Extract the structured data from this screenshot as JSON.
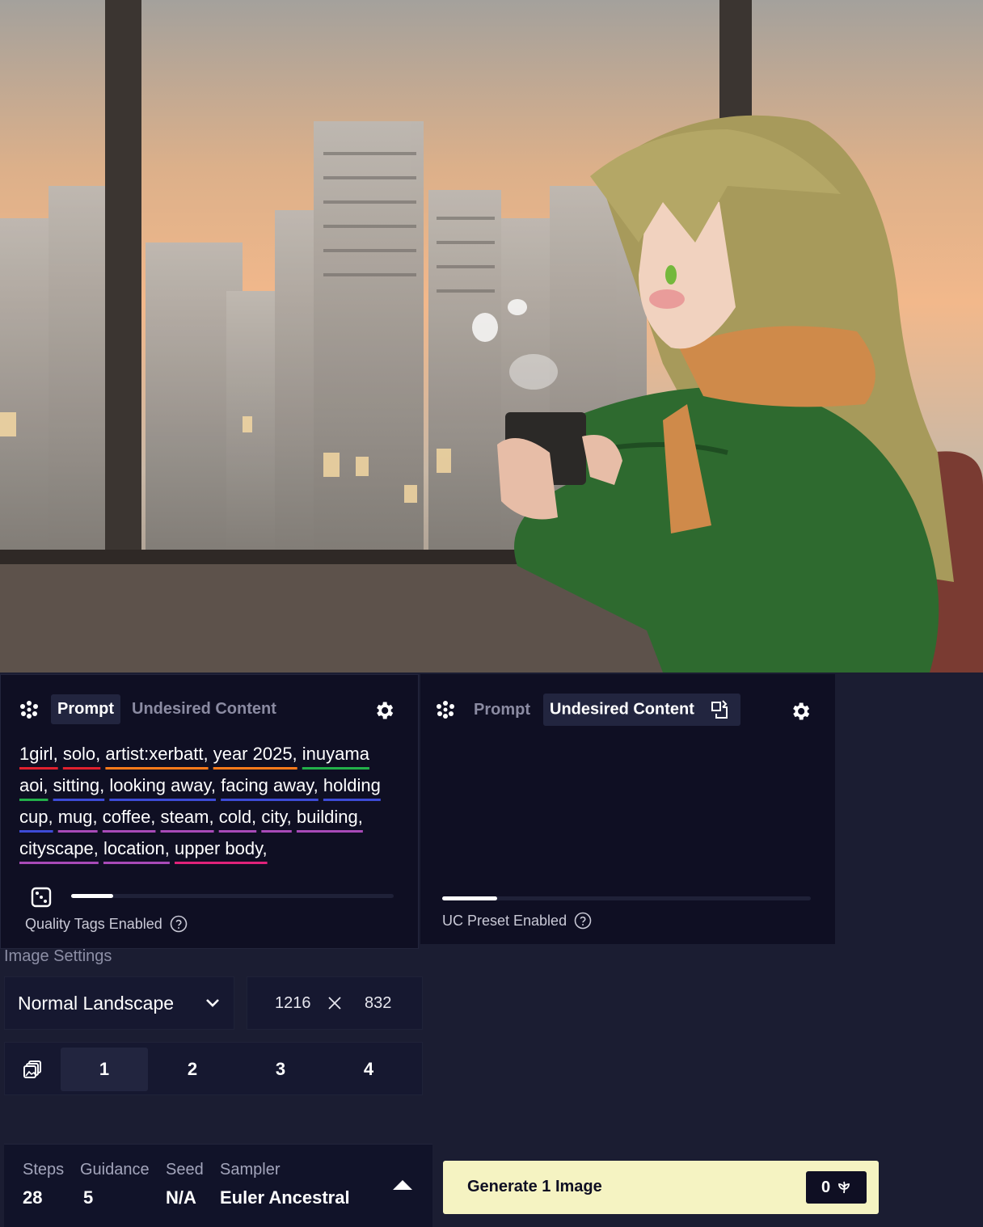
{
  "artwork": {
    "alt_icon": "generated-image"
  },
  "prompt_panel": {
    "tabs": {
      "prompt": "Prompt",
      "undesired": "Undesired Content"
    },
    "tags": [
      {
        "text": "1girl,",
        "underline": "#e0202e"
      },
      {
        "text": "solo,",
        "underline": "#e0202e"
      },
      {
        "text": "artist:xerbatt,",
        "underline": "#ff7a1a"
      },
      {
        "text": "year 2025,",
        "underline": "#ff7a1a"
      },
      {
        "text": "inuyama aoi,",
        "underline": "#22b04a"
      },
      {
        "text": "sitting,",
        "underline": "#3d4bd6"
      },
      {
        "text": "looking away,",
        "underline": "#3d4bd6"
      },
      {
        "text": "facing away,",
        "underline": "#3d4bd6"
      },
      {
        "text": "holding cup,",
        "underline": "#3d4bd6"
      },
      {
        "text": "mug,",
        "underline": "#a84ab8"
      },
      {
        "text": "coffee,",
        "underline": "#a84ab8"
      },
      {
        "text": "steam,",
        "underline": "#a84ab8"
      },
      {
        "text": "cold,",
        "underline": "#a84ab8"
      },
      {
        "text": "city,",
        "underline": "#a84ab8"
      },
      {
        "text": "building,",
        "underline": "#a84ab8"
      },
      {
        "text": "cityscape,",
        "underline": "#a84ab8"
      },
      {
        "text": "location,",
        "underline": "#a84ab8"
      },
      {
        "text": "upper body,",
        "underline": "#e0227a"
      }
    ],
    "quality_label": "Quality Tags Enabled",
    "strength": 0.13
  },
  "uc_panel": {
    "tabs": {
      "prompt": "Prompt",
      "undesired": "Undesired Content"
    },
    "preset_label": "UC Preset Enabled",
    "strength": 0.15
  },
  "image_settings": {
    "label": "Image Settings",
    "preset": "Normal Landscape",
    "width": "1216",
    "height": "832",
    "counts": [
      "1",
      "2",
      "3",
      "4"
    ],
    "selected_count": "1"
  },
  "params": {
    "steps_label": "Steps",
    "steps": "28",
    "guidance_label": "Guidance",
    "guidance": "5",
    "seed_label": "Seed",
    "seed": "N/A",
    "sampler_label": "Sampler",
    "sampler": "Euler Ancestral"
  },
  "generate": {
    "label": "Generate 1 Image",
    "cost": "0"
  },
  "colors": {
    "panel": "#0f0f23",
    "page": "#1b1d32",
    "active_tab": "#22253f",
    "generate": "#f5f3c2"
  }
}
